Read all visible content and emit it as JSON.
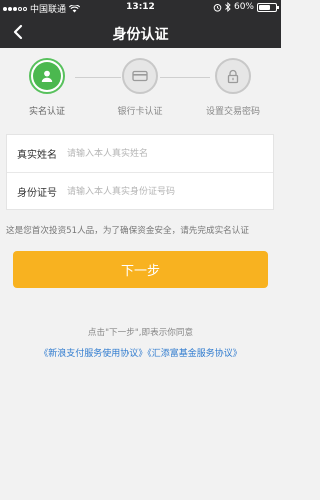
{
  "status_bar": {
    "carrier": "中国联通",
    "time": "13:12",
    "battery": "60%",
    "battery_level": 0.6
  },
  "nav": {
    "title": "身份认证",
    "back_icon": "chevron-left-icon"
  },
  "steps": [
    {
      "label": "实名认证",
      "icon": "user-icon",
      "active": true
    },
    {
      "label": "银行卡认证",
      "icon": "card-icon",
      "active": false
    },
    {
      "label": "设置交易密码",
      "icon": "lock-icon",
      "active": false
    }
  ],
  "form": {
    "name_label": "真实姓名",
    "name_placeholder": "请输入本人真实姓名",
    "id_label": "身份证号",
    "id_placeholder": "请输入本人真实身份证号码"
  },
  "notice": "这是您首次投资51人品，为了确保资金安全，请先完成实名认证",
  "next_button": "下一步",
  "agreement": {
    "text": "点击\"下一步\",即表示你同意",
    "link1": "《新浪支付服务使用协议》",
    "link2": "《汇添富基金服务协议》"
  },
  "colors": {
    "accent": "#f8b220",
    "active_step": "#4bb84f",
    "link": "#2f7bcf",
    "header": "#2d2d2f"
  }
}
